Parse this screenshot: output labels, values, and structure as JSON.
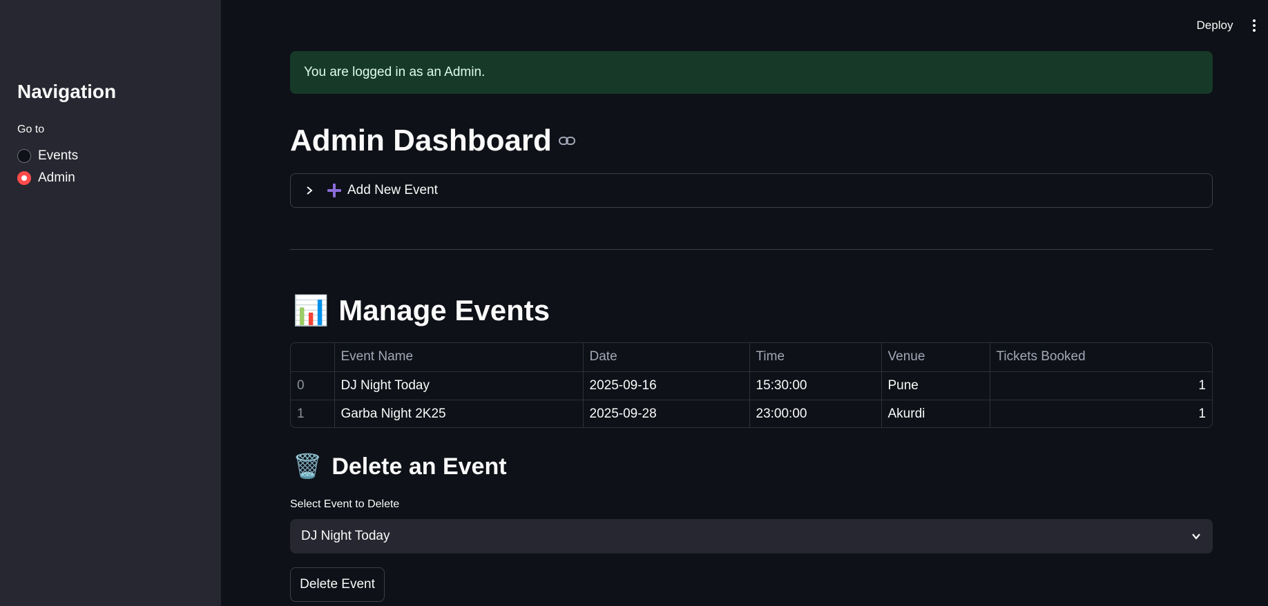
{
  "sidebar": {
    "title": "Navigation",
    "radio_label": "Go to",
    "options": [
      {
        "label": "Events",
        "selected": false
      },
      {
        "label": "Admin",
        "selected": true
      }
    ]
  },
  "header": {
    "deploy_label": "Deploy",
    "menu_icon": "more-vertical-icon"
  },
  "alert": {
    "text": "You are logged in as an Admin.",
    "type": "success"
  },
  "main": {
    "title": "Admin Dashboard",
    "title_icon": "link-icon",
    "expander": {
      "label": "Add New Event",
      "icon": "plus-icon",
      "expanded": false
    },
    "manage": {
      "emoji": "📊",
      "heading": "Manage Events",
      "table": {
        "columns": [
          "",
          "Event Name",
          "Date",
          "Time",
          "Venue",
          "Tickets Booked"
        ],
        "rows": [
          {
            "index": "0",
            "event_name": "DJ Night Today",
            "date": "2025-09-16",
            "time": "15:30:00",
            "venue": "Pune",
            "tickets": "1"
          },
          {
            "index": "1",
            "event_name": "Garba Night 2K25",
            "date": "2025-09-28",
            "time": "23:00:00",
            "venue": "Akurdi",
            "tickets": "1"
          }
        ]
      }
    },
    "delete": {
      "emoji": "🗑️",
      "heading": "Delete an Event",
      "select_label": "Select Event to Delete",
      "select_value": "DJ Night Today",
      "button_label": "Delete Event"
    }
  },
  "colors": {
    "background": "#0e1117",
    "sidebar": "#262730",
    "accent": "#ff4b4b",
    "success_bg": "#173928",
    "plus_icon": "#8d6cd9"
  }
}
